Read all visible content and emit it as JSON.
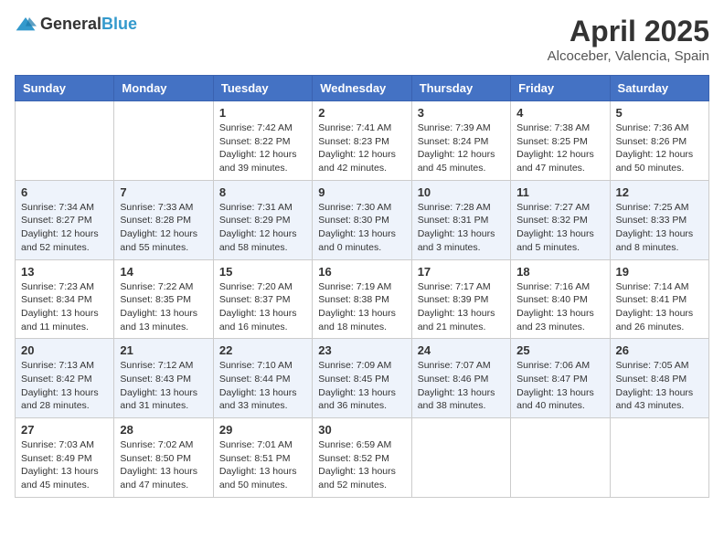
{
  "header": {
    "logo_general": "General",
    "logo_blue": "Blue",
    "title": "April 2025",
    "subtitle": "Alcoceber, Valencia, Spain"
  },
  "calendar": {
    "days_of_week": [
      "Sunday",
      "Monday",
      "Tuesday",
      "Wednesday",
      "Thursday",
      "Friday",
      "Saturday"
    ],
    "weeks": [
      [
        {
          "day": "",
          "sunrise": "",
          "sunset": "",
          "daylight": ""
        },
        {
          "day": "",
          "sunrise": "",
          "sunset": "",
          "daylight": ""
        },
        {
          "day": "1",
          "sunrise": "Sunrise: 7:42 AM",
          "sunset": "Sunset: 8:22 PM",
          "daylight": "Daylight: 12 hours and 39 minutes."
        },
        {
          "day": "2",
          "sunrise": "Sunrise: 7:41 AM",
          "sunset": "Sunset: 8:23 PM",
          "daylight": "Daylight: 12 hours and 42 minutes."
        },
        {
          "day": "3",
          "sunrise": "Sunrise: 7:39 AM",
          "sunset": "Sunset: 8:24 PM",
          "daylight": "Daylight: 12 hours and 45 minutes."
        },
        {
          "day": "4",
          "sunrise": "Sunrise: 7:38 AM",
          "sunset": "Sunset: 8:25 PM",
          "daylight": "Daylight: 12 hours and 47 minutes."
        },
        {
          "day": "5",
          "sunrise": "Sunrise: 7:36 AM",
          "sunset": "Sunset: 8:26 PM",
          "daylight": "Daylight: 12 hours and 50 minutes."
        }
      ],
      [
        {
          "day": "6",
          "sunrise": "Sunrise: 7:34 AM",
          "sunset": "Sunset: 8:27 PM",
          "daylight": "Daylight: 12 hours and 52 minutes."
        },
        {
          "day": "7",
          "sunrise": "Sunrise: 7:33 AM",
          "sunset": "Sunset: 8:28 PM",
          "daylight": "Daylight: 12 hours and 55 minutes."
        },
        {
          "day": "8",
          "sunrise": "Sunrise: 7:31 AM",
          "sunset": "Sunset: 8:29 PM",
          "daylight": "Daylight: 12 hours and 58 minutes."
        },
        {
          "day": "9",
          "sunrise": "Sunrise: 7:30 AM",
          "sunset": "Sunset: 8:30 PM",
          "daylight": "Daylight: 13 hours and 0 minutes."
        },
        {
          "day": "10",
          "sunrise": "Sunrise: 7:28 AM",
          "sunset": "Sunset: 8:31 PM",
          "daylight": "Daylight: 13 hours and 3 minutes."
        },
        {
          "day": "11",
          "sunrise": "Sunrise: 7:27 AM",
          "sunset": "Sunset: 8:32 PM",
          "daylight": "Daylight: 13 hours and 5 minutes."
        },
        {
          "day": "12",
          "sunrise": "Sunrise: 7:25 AM",
          "sunset": "Sunset: 8:33 PM",
          "daylight": "Daylight: 13 hours and 8 minutes."
        }
      ],
      [
        {
          "day": "13",
          "sunrise": "Sunrise: 7:23 AM",
          "sunset": "Sunset: 8:34 PM",
          "daylight": "Daylight: 13 hours and 11 minutes."
        },
        {
          "day": "14",
          "sunrise": "Sunrise: 7:22 AM",
          "sunset": "Sunset: 8:35 PM",
          "daylight": "Daylight: 13 hours and 13 minutes."
        },
        {
          "day": "15",
          "sunrise": "Sunrise: 7:20 AM",
          "sunset": "Sunset: 8:37 PM",
          "daylight": "Daylight: 13 hours and 16 minutes."
        },
        {
          "day": "16",
          "sunrise": "Sunrise: 7:19 AM",
          "sunset": "Sunset: 8:38 PM",
          "daylight": "Daylight: 13 hours and 18 minutes."
        },
        {
          "day": "17",
          "sunrise": "Sunrise: 7:17 AM",
          "sunset": "Sunset: 8:39 PM",
          "daylight": "Daylight: 13 hours and 21 minutes."
        },
        {
          "day": "18",
          "sunrise": "Sunrise: 7:16 AM",
          "sunset": "Sunset: 8:40 PM",
          "daylight": "Daylight: 13 hours and 23 minutes."
        },
        {
          "day": "19",
          "sunrise": "Sunrise: 7:14 AM",
          "sunset": "Sunset: 8:41 PM",
          "daylight": "Daylight: 13 hours and 26 minutes."
        }
      ],
      [
        {
          "day": "20",
          "sunrise": "Sunrise: 7:13 AM",
          "sunset": "Sunset: 8:42 PM",
          "daylight": "Daylight: 13 hours and 28 minutes."
        },
        {
          "day": "21",
          "sunrise": "Sunrise: 7:12 AM",
          "sunset": "Sunset: 8:43 PM",
          "daylight": "Daylight: 13 hours and 31 minutes."
        },
        {
          "day": "22",
          "sunrise": "Sunrise: 7:10 AM",
          "sunset": "Sunset: 8:44 PM",
          "daylight": "Daylight: 13 hours and 33 minutes."
        },
        {
          "day": "23",
          "sunrise": "Sunrise: 7:09 AM",
          "sunset": "Sunset: 8:45 PM",
          "daylight": "Daylight: 13 hours and 36 minutes."
        },
        {
          "day": "24",
          "sunrise": "Sunrise: 7:07 AM",
          "sunset": "Sunset: 8:46 PM",
          "daylight": "Daylight: 13 hours and 38 minutes."
        },
        {
          "day": "25",
          "sunrise": "Sunrise: 7:06 AM",
          "sunset": "Sunset: 8:47 PM",
          "daylight": "Daylight: 13 hours and 40 minutes."
        },
        {
          "day": "26",
          "sunrise": "Sunrise: 7:05 AM",
          "sunset": "Sunset: 8:48 PM",
          "daylight": "Daylight: 13 hours and 43 minutes."
        }
      ],
      [
        {
          "day": "27",
          "sunrise": "Sunrise: 7:03 AM",
          "sunset": "Sunset: 8:49 PM",
          "daylight": "Daylight: 13 hours and 45 minutes."
        },
        {
          "day": "28",
          "sunrise": "Sunrise: 7:02 AM",
          "sunset": "Sunset: 8:50 PM",
          "daylight": "Daylight: 13 hours and 47 minutes."
        },
        {
          "day": "29",
          "sunrise": "Sunrise: 7:01 AM",
          "sunset": "Sunset: 8:51 PM",
          "daylight": "Daylight: 13 hours and 50 minutes."
        },
        {
          "day": "30",
          "sunrise": "Sunrise: 6:59 AM",
          "sunset": "Sunset: 8:52 PM",
          "daylight": "Daylight: 13 hours and 52 minutes."
        },
        {
          "day": "",
          "sunrise": "",
          "sunset": "",
          "daylight": ""
        },
        {
          "day": "",
          "sunrise": "",
          "sunset": "",
          "daylight": ""
        },
        {
          "day": "",
          "sunrise": "",
          "sunset": "",
          "daylight": ""
        }
      ]
    ]
  }
}
